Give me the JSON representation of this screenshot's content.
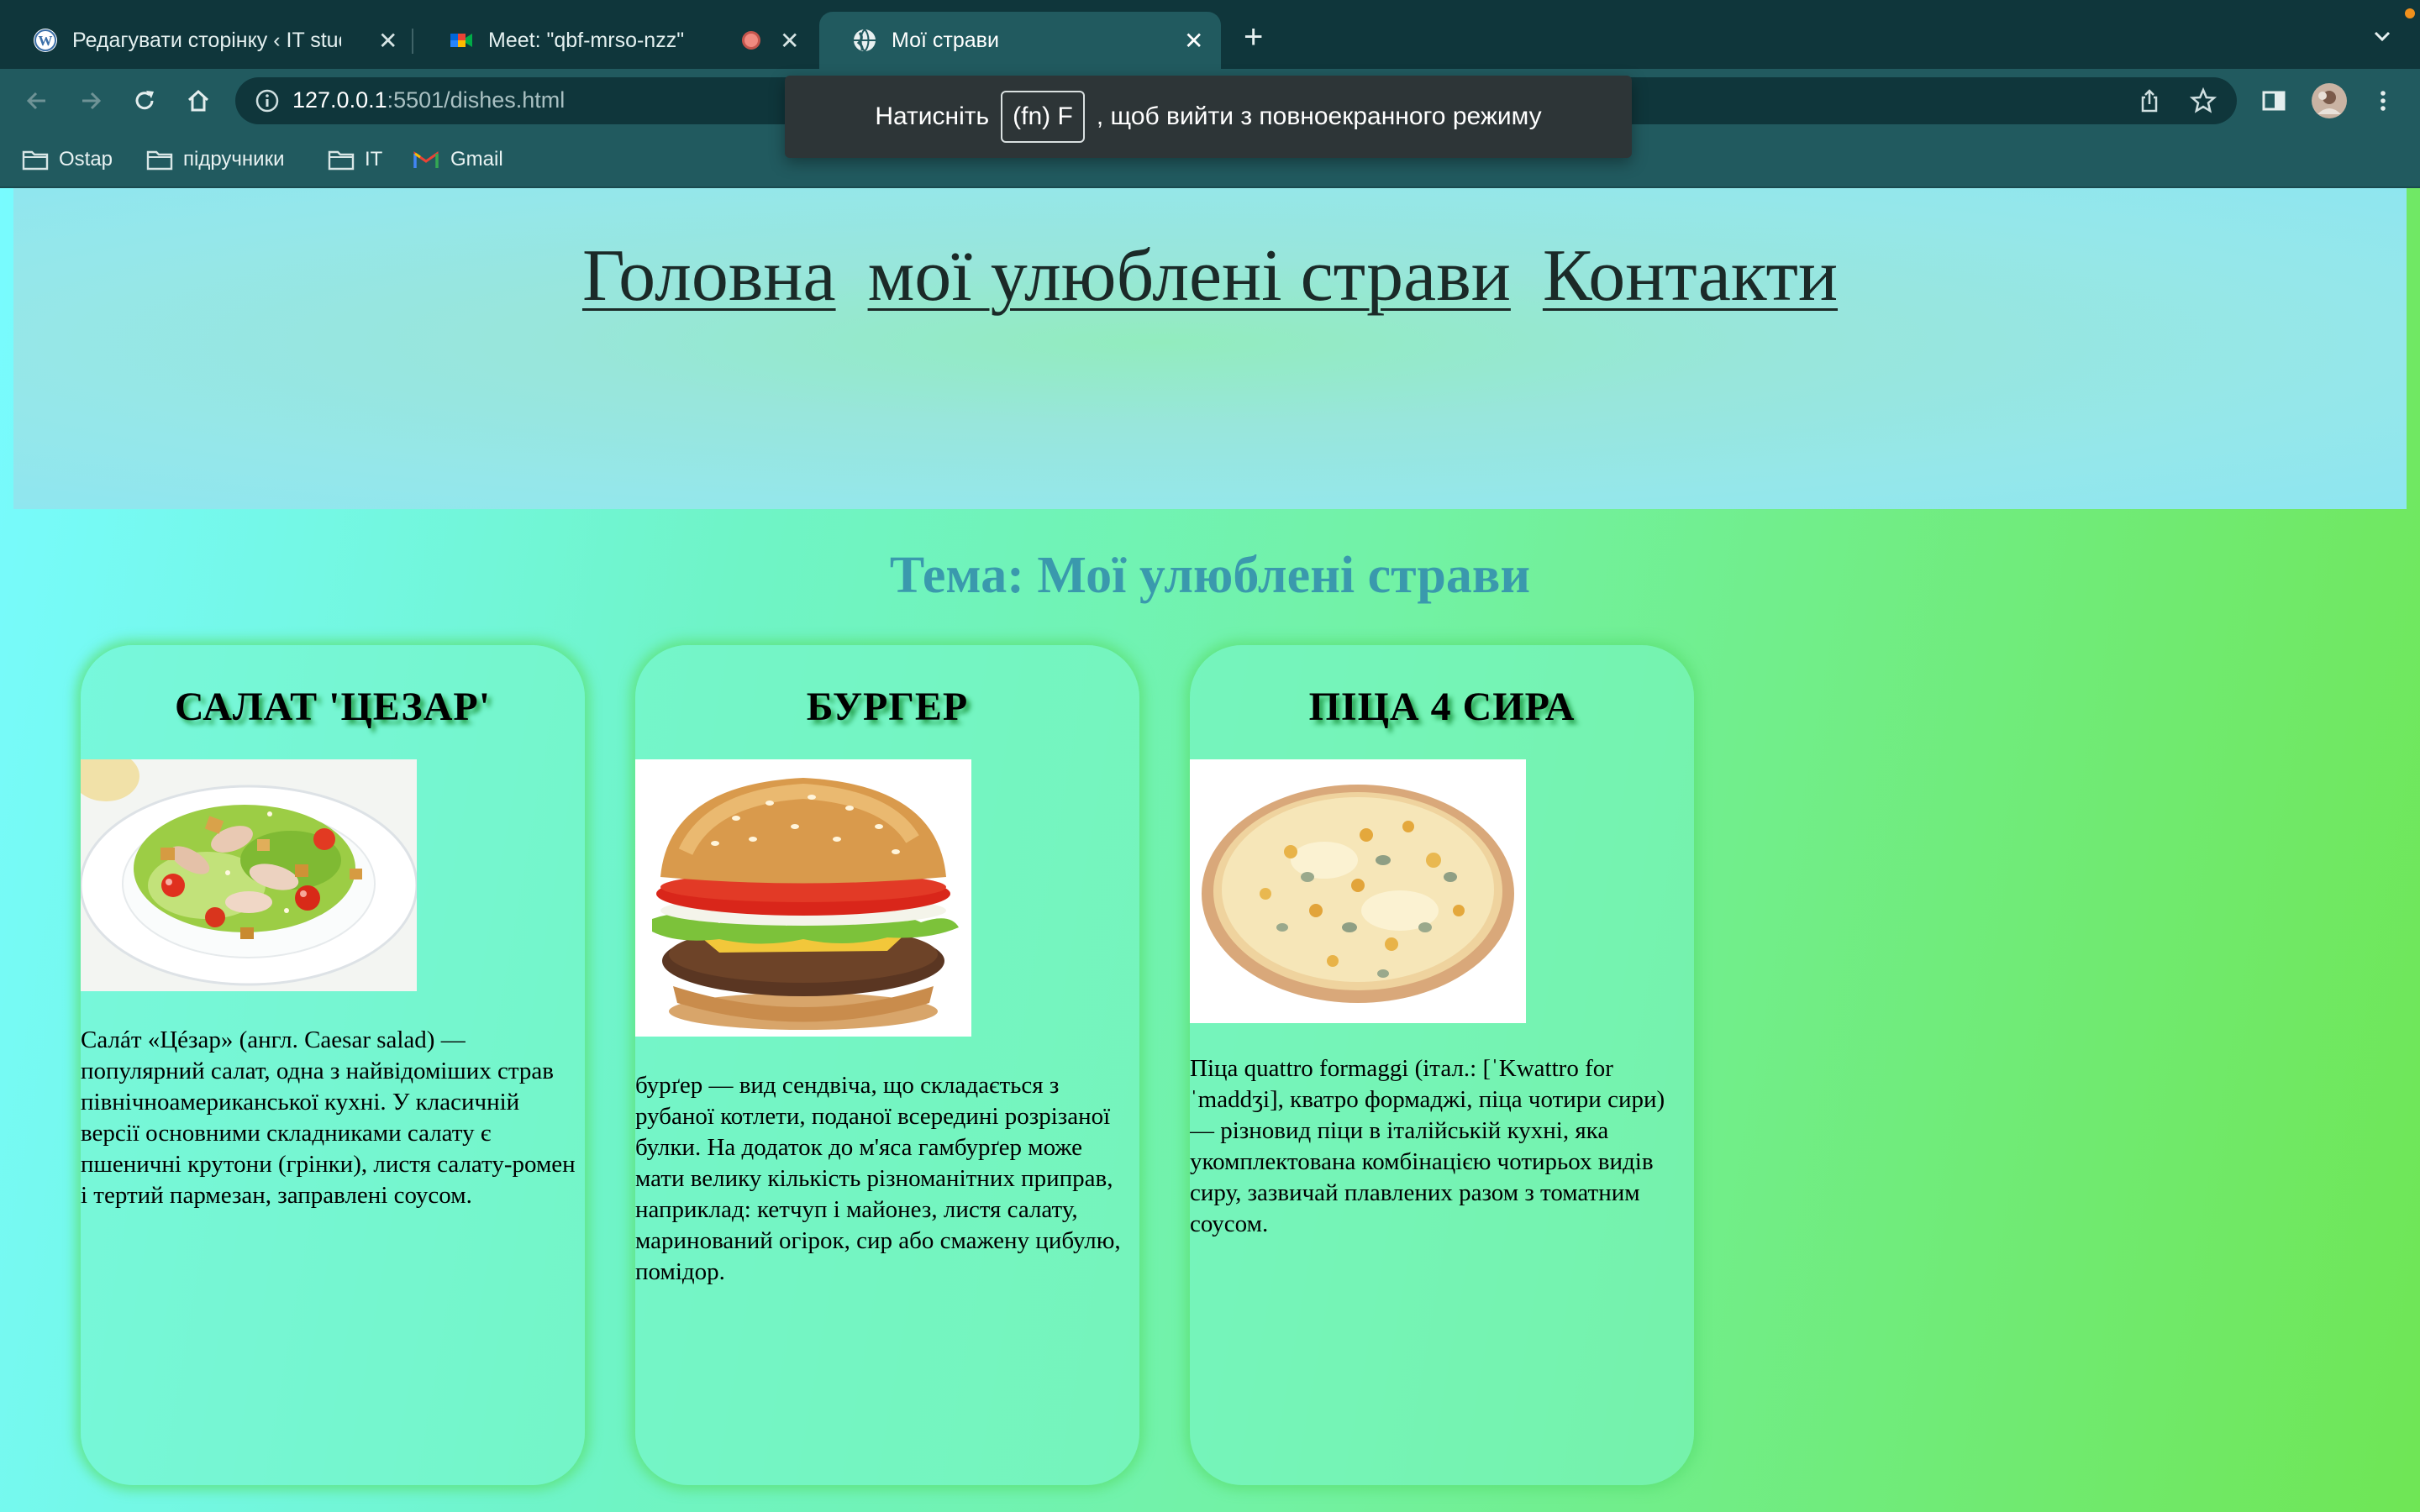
{
  "browser": {
    "tabs": [
      {
        "title": "Редагувати сторінку ‹ IT studi",
        "favicon": "wordpress-icon"
      },
      {
        "title": "Meet: \"qbf-mrso-nzz\"",
        "favicon": "google-meet-icon",
        "recording": true
      },
      {
        "title": "Мої страви",
        "favicon": "globe-icon",
        "active": true
      }
    ],
    "new_tab": "+",
    "url_host": "127.0.0.1",
    "url_path": ":5501/dishes.html",
    "bookmarks": [
      {
        "label": "Ostap",
        "icon": "folder-icon"
      },
      {
        "label": "підручники",
        "icon": "folder-icon"
      },
      {
        "label": "IT",
        "icon": "folder-icon"
      },
      {
        "label": "Gmail",
        "icon": "gmail-icon"
      }
    ],
    "fullscreen_notice": {
      "before": "Натисніть",
      "key": "(fn) F",
      "after": ", щоб вийти з повноекранного режиму"
    }
  },
  "page": {
    "nav": [
      "Головна",
      "мої улюблені страви",
      "Контакти"
    ],
    "topic": "Тема: Мої улюблені страви",
    "cards": [
      {
        "title": "САЛАТ 'ЦЕЗАР'",
        "image": "caesar-salad-image",
        "text": "Салáт «Цéзар» (англ. Caesar salad) — популярний салат, одна з найвідоміших страв північноамериканської кухні. У класичній версії основними складниками салату є пшеничні крутони (грінки), листя салату-ромен і тертий пармезан, заправлені соусом."
      },
      {
        "title": "БУРГЕР",
        "image": "burger-image",
        "text": "бурґер — вид сендвіча, що складається з рубаної котлети, поданої всередині розрізаної булки. На додаток до м'яса гамбурґер може мати велику кількість різноманітних приправ, наприклад: кетчуп і майонез, листя салату, маринований огірок, сир або смажену цибулю, помідор."
      },
      {
        "title": "ПІЦА 4 СИРА",
        "image": "pizza-image",
        "text": "Піца quattro formaggi (італ.: [ˈKwattro for ˈmaddʒi], кватро формаджі, піца чотири сири) — різновид піци в італійській кухні, яка укомплектована комбінацією чотирьох видів сиру, зазвичай плавлених разом з томатним соусом."
      }
    ]
  }
}
